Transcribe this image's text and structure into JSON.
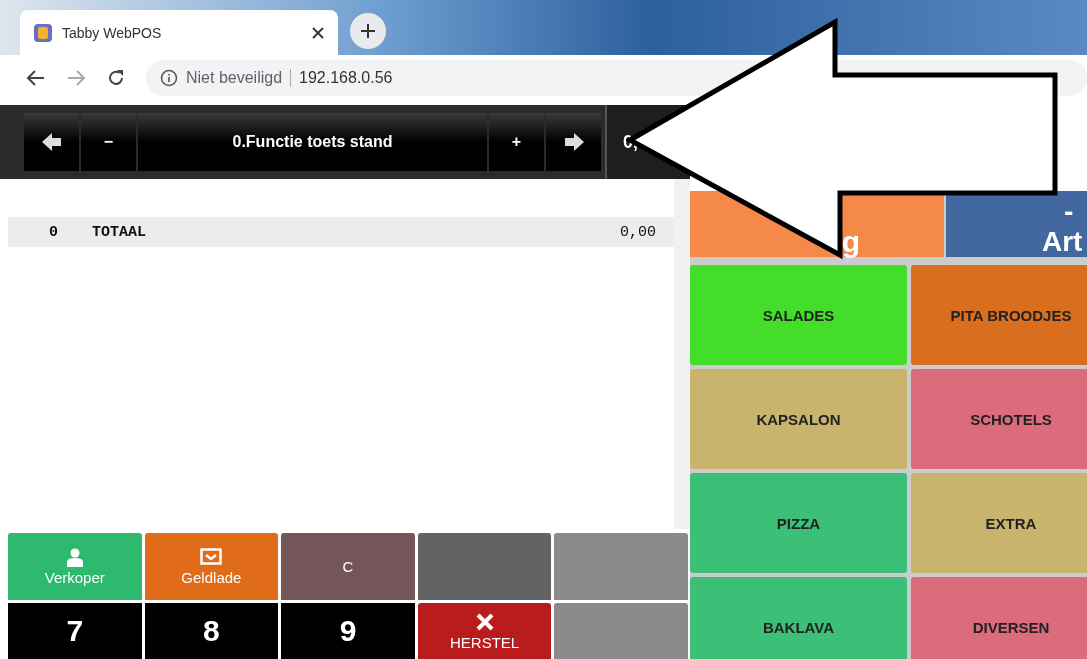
{
  "browser": {
    "tab_title": "Tabby WebPOS",
    "security_label": "Niet beveiligd",
    "url": "192.168.0.56"
  },
  "toolbar": {
    "buttons": [
      {
        "kind": "prev"
      },
      {
        "kind": "text",
        "label": "−"
      },
      {
        "kind": "title",
        "label": "0.Functie toets stand"
      },
      {
        "kind": "text",
        "label": "+"
      },
      {
        "kind": "next"
      }
    ],
    "display": "0,"
  },
  "receipt": {
    "rows": [
      {
        "qty": "0",
        "label": "TOTAAL",
        "amount": "0,00"
      }
    ]
  },
  "category_tabs": [
    {
      "line_2": "g",
      "color": "#f5894a"
    },
    {
      "line_1": "-",
      "line_2": "Art",
      "color": "#43679f"
    }
  ],
  "groups": [
    {
      "label": "SALADES",
      "color": "#44dd2a"
    },
    {
      "label": "PITA BROODJES",
      "color": "#d86e1e"
    },
    {
      "label": "KAPSALON",
      "color": "#c9b46e"
    },
    {
      "label": "SCHOTELS",
      "color": "#dc6b7b"
    },
    {
      "label": "PIZZA",
      "color": "#3cbf76"
    },
    {
      "label": "EXTRA",
      "color": "#c9b46e"
    },
    {
      "label": "BAKLAVA",
      "color": "#3cbf76"
    },
    {
      "label": "DIVERSEN",
      "color": "#dc6b7b"
    }
  ],
  "keypad": [
    {
      "kind": "seller",
      "label": "Verkoper",
      "color": "#2dba6e"
    },
    {
      "kind": "drawer",
      "label": "Geldlade",
      "color": "#e06c1a"
    },
    {
      "kind": "clear",
      "label": "C",
      "color": "#74565a"
    },
    {
      "kind": "blank",
      "color": "#636363"
    },
    {
      "kind": "blank",
      "color": "#8a8a8a"
    },
    {
      "kind": "digit",
      "label": "7",
      "color": "#000000"
    },
    {
      "kind": "digit",
      "label": "8",
      "color": "#000000"
    },
    {
      "kind": "digit",
      "label": "9",
      "color": "#000000"
    },
    {
      "kind": "undo",
      "label": "HERSTEL",
      "color": "#b91c1c"
    },
    {
      "kind": "blank",
      "color": "#8a8a8a"
    }
  ]
}
